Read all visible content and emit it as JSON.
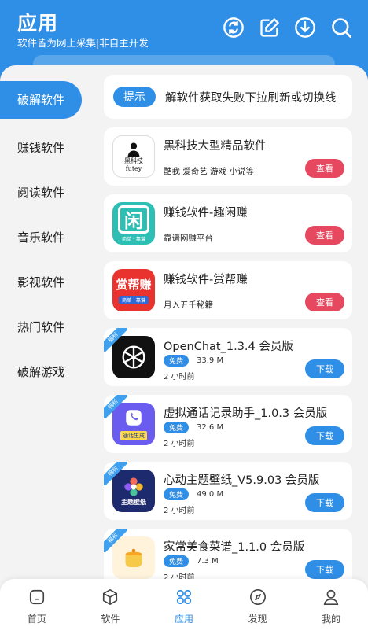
{
  "header": {
    "title": "应用",
    "subtitle": "软件皆为网上采集|非自主开发",
    "icons": [
      "refresh-icon",
      "edit-icon",
      "download-icon",
      "search-icon"
    ]
  },
  "sidebar": {
    "items": [
      {
        "label": "破解软件",
        "active": true
      },
      {
        "label": "赚钱软件"
      },
      {
        "label": "阅读软件"
      },
      {
        "label": "音乐软件"
      },
      {
        "label": "影视软件"
      },
      {
        "label": "热门软件"
      },
      {
        "label": "破解游戏"
      }
    ]
  },
  "notice": {
    "badge": "提示",
    "text": "解软件获取失败下拉刷新或切换线"
  },
  "cards": [
    {
      "title": "黑科技大型精品软件",
      "desc": "酷我 爱奇艺 游戏 小说等",
      "button": "查看",
      "icon_text": "黑科技",
      "icon_sub": "futey"
    },
    {
      "title": "赚钱软件-趣闲赚",
      "desc": "靠谱网赚平台",
      "button": "查看",
      "icon_text": "闲",
      "icon_sub": "简单 · 靠谱"
    },
    {
      "title": "赚钱软件-赏帮赚",
      "desc": "月入五千秘籍",
      "button": "查看",
      "icon_text": "赏帮赚",
      "icon_sub": "简单 · 靠谱"
    }
  ],
  "apps": [
    {
      "title": "OpenChat_1.3.4 会员版",
      "badge": "免费",
      "size": "33.9 M",
      "time": "2 小时前",
      "button": "下载",
      "corner": "福利"
    },
    {
      "title": "虚拟通话记录助手_1.0.3 会员版",
      "badge": "免费",
      "size": "32.6 M",
      "time": "2 小时前",
      "button": "下载",
      "corner": "福利",
      "icon_text": "通话生成"
    },
    {
      "title": "心动主题壁纸_V5.9.03 会员版",
      "badge": "免费",
      "size": "49.0 M",
      "time": "2 小时前",
      "button": "下载",
      "corner": "福利",
      "icon_text": "主题壁纸"
    },
    {
      "title": "家常美食菜谱_1.1.0 会员版",
      "badge": "免费",
      "size": "7.3 M",
      "time": "2 小时前",
      "button": "下载",
      "corner": "福利"
    }
  ],
  "bottom_nav": [
    {
      "label": "首页",
      "icon": "home-icon"
    },
    {
      "label": "软件",
      "icon": "cube-icon"
    },
    {
      "label": "应用",
      "icon": "apps-icon",
      "active": true
    },
    {
      "label": "发现",
      "icon": "compass-icon"
    },
    {
      "label": "我的",
      "icon": "user-icon"
    }
  ],
  "colors": {
    "primary": "#2f8ee6",
    "view_button": "#e5485f",
    "background": "#f3f3f3"
  }
}
